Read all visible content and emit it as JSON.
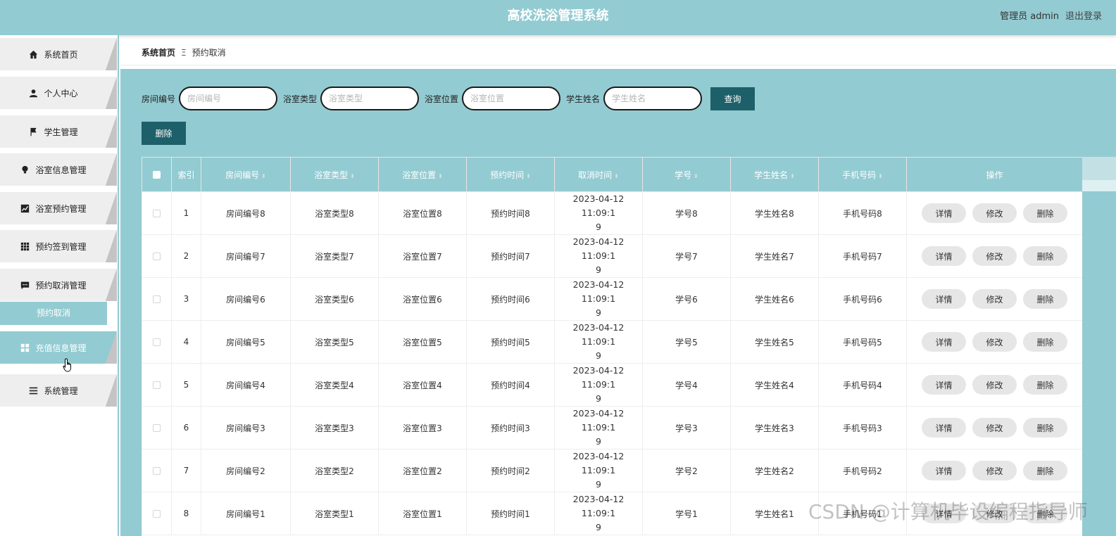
{
  "header": {
    "title": "高校洗浴管理系统",
    "role_user": "管理员 admin",
    "logout": "退出登录"
  },
  "sidebar": {
    "items": [
      {
        "label": "系统首页",
        "icon": "home-icon"
      },
      {
        "label": "个人中心",
        "icon": "user-icon"
      },
      {
        "label": "学生管理",
        "icon": "flag-icon"
      },
      {
        "label": "浴室信息管理",
        "icon": "bulb-icon"
      },
      {
        "label": "浴室预约管理",
        "icon": "chart-icon"
      },
      {
        "label": "预约签到管理",
        "icon": "grid-icon"
      },
      {
        "label": "预约取消管理",
        "icon": "message-icon"
      },
      {
        "label": "充值信息管理",
        "icon": "apps-icon"
      },
      {
        "label": "系统管理",
        "icon": "menu-icon"
      }
    ],
    "sub_item": "预约取消"
  },
  "breadcrumb": {
    "home": "系统首页",
    "sep": "Ξ",
    "current": "预约取消"
  },
  "search": {
    "room_label": "房间编号",
    "room_placeholder": "房间编号",
    "type_label": "浴室类型",
    "type_placeholder": "浴室类型",
    "location_label": "浴室位置",
    "location_placeholder": "浴室位置",
    "name_label": "学生姓名",
    "name_placeholder": "学生姓名",
    "query_button": "查询",
    "delete_button": "删除"
  },
  "table": {
    "headers": [
      "索引",
      "房间编号",
      "浴室类型",
      "浴室位置",
      "预约时间",
      "取消时间",
      "学号",
      "学生姓名",
      "手机号码",
      "操作"
    ],
    "buttons": {
      "detail": "详情",
      "edit": "修改",
      "delete": "删除"
    },
    "rows": [
      {
        "index": "1",
        "room": "房间编号8",
        "type": "浴室类型8",
        "location": "浴室位置8",
        "reserve_time": "预约时间8",
        "cancel_time_a": "2023-04-12 11:09:1",
        "cancel_time_b": "9",
        "student_no": "学号8",
        "student_name": "学生姓名8",
        "phone": "手机号码8"
      },
      {
        "index": "2",
        "room": "房间编号7",
        "type": "浴室类型7",
        "location": "浴室位置7",
        "reserve_time": "预约时间7",
        "cancel_time_a": "2023-04-12 11:09:1",
        "cancel_time_b": "9",
        "student_no": "学号7",
        "student_name": "学生姓名7",
        "phone": "手机号码7"
      },
      {
        "index": "3",
        "room": "房间编号6",
        "type": "浴室类型6",
        "location": "浴室位置6",
        "reserve_time": "预约时间6",
        "cancel_time_a": "2023-04-12 11:09:1",
        "cancel_time_b": "9",
        "student_no": "学号6",
        "student_name": "学生姓名6",
        "phone": "手机号码6"
      },
      {
        "index": "4",
        "room": "房间编号5",
        "type": "浴室类型5",
        "location": "浴室位置5",
        "reserve_time": "预约时间5",
        "cancel_time_a": "2023-04-12 11:09:1",
        "cancel_time_b": "9",
        "student_no": "学号5",
        "student_name": "学生姓名5",
        "phone": "手机号码5"
      },
      {
        "index": "5",
        "room": "房间编号4",
        "type": "浴室类型4",
        "location": "浴室位置4",
        "reserve_time": "预约时间4",
        "cancel_time_a": "2023-04-12 11:09:1",
        "cancel_time_b": "9",
        "student_no": "学号4",
        "student_name": "学生姓名4",
        "phone": "手机号码4"
      },
      {
        "index": "6",
        "room": "房间编号3",
        "type": "浴室类型3",
        "location": "浴室位置3",
        "reserve_time": "预约时间3",
        "cancel_time_a": "2023-04-12 11:09:1",
        "cancel_time_b": "9",
        "student_no": "学号3",
        "student_name": "学生姓名3",
        "phone": "手机号码3"
      },
      {
        "index": "7",
        "room": "房间编号2",
        "type": "浴室类型2",
        "location": "浴室位置2",
        "reserve_time": "预约时间2",
        "cancel_time_a": "2023-04-12 11:09:1",
        "cancel_time_b": "9",
        "student_no": "学号2",
        "student_name": "学生姓名2",
        "phone": "手机号码2"
      },
      {
        "index": "8",
        "room": "房间编号1",
        "type": "浴室类型1",
        "location": "浴室位置1",
        "reserve_time": "预约时间1",
        "cancel_time_a": "2023-04-12 11:09:1",
        "cancel_time_b": "9",
        "student_no": "学号1",
        "student_name": "学生姓名1",
        "phone": "手机号码1"
      }
    ]
  },
  "watermark": "CSDN @计算机毕设编程指导师",
  "colors": {
    "accent": "#93cbd2",
    "button_dark": "#1e6069"
  }
}
